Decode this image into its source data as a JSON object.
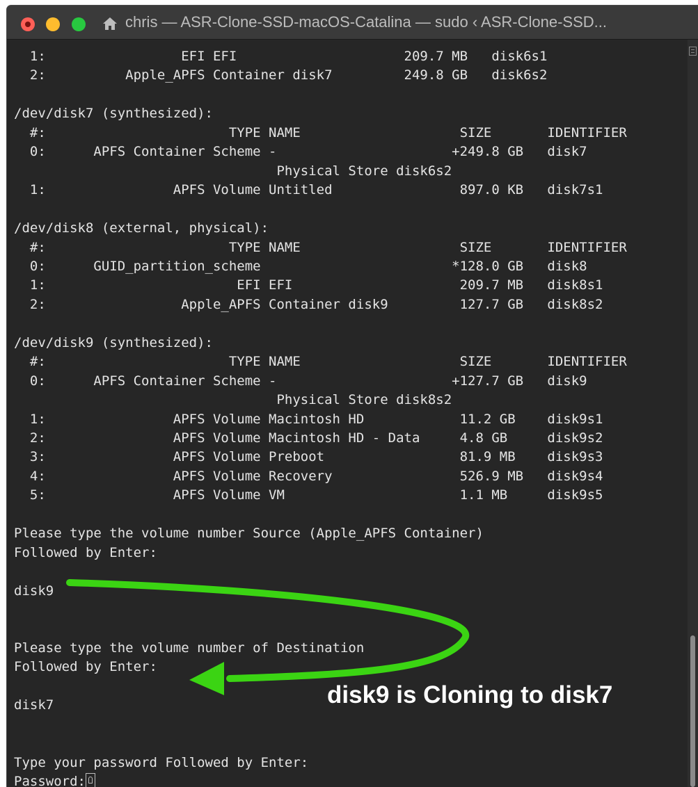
{
  "window": {
    "title": "chris — ASR-Clone-SSD-macOS-Catalina — sudo ‹ ASR-Clone-SSD...",
    "colors": {
      "background": "#262626",
      "text": "#e4e4e4",
      "arrow": "#3bd413",
      "close": "#ff5f57",
      "minimize": "#febc2e",
      "zoom": "#28c840"
    }
  },
  "terminal": {
    "lines": [
      "  1:                 EFI EFI                     209.7 MB   disk6s1",
      "  2:          Apple_APFS Container disk7         249.8 GB   disk6s2",
      "",
      "/dev/disk7 (synthesized):",
      "  #:                       TYPE NAME                    SIZE       IDENTIFIER",
      "  0:      APFS Container Scheme -                      +249.8 GB   disk7",
      "                                 Physical Store disk6s2",
      "  1:                APFS Volume Untitled                897.0 KB   disk7s1",
      "",
      "/dev/disk8 (external, physical):",
      "  #:                       TYPE NAME                    SIZE       IDENTIFIER",
      "  0:      GUID_partition_scheme                        *128.0 GB   disk8",
      "  1:                        EFI EFI                     209.7 MB   disk8s1",
      "  2:                 Apple_APFS Container disk9         127.7 GB   disk8s2",
      "",
      "/dev/disk9 (synthesized):",
      "  #:                       TYPE NAME                    SIZE       IDENTIFIER",
      "  0:      APFS Container Scheme -                      +127.7 GB   disk9",
      "                                 Physical Store disk8s2",
      "  1:                APFS Volume Macintosh HD            11.2 GB    disk9s1",
      "  2:                APFS Volume Macintosh HD - Data     4.8 GB     disk9s2",
      "  3:                APFS Volume Preboot                 81.9 MB    disk9s3",
      "  4:                APFS Volume Recovery                526.9 MB   disk9s4",
      "  5:                APFS Volume VM                      1.1 MB     disk9s5",
      "",
      "Please type the volume number Source (Apple_APFS Container)",
      "Followed by Enter:",
      "",
      "disk9",
      "",
      "",
      "Please type the volume number of Destination",
      "Followed by Enter:",
      "",
      "disk7",
      "",
      "",
      "Type your password Followed by Enter:"
    ],
    "prompt": "Password:"
  },
  "annotation": {
    "text": "disk9 is Cloning to disk7"
  }
}
